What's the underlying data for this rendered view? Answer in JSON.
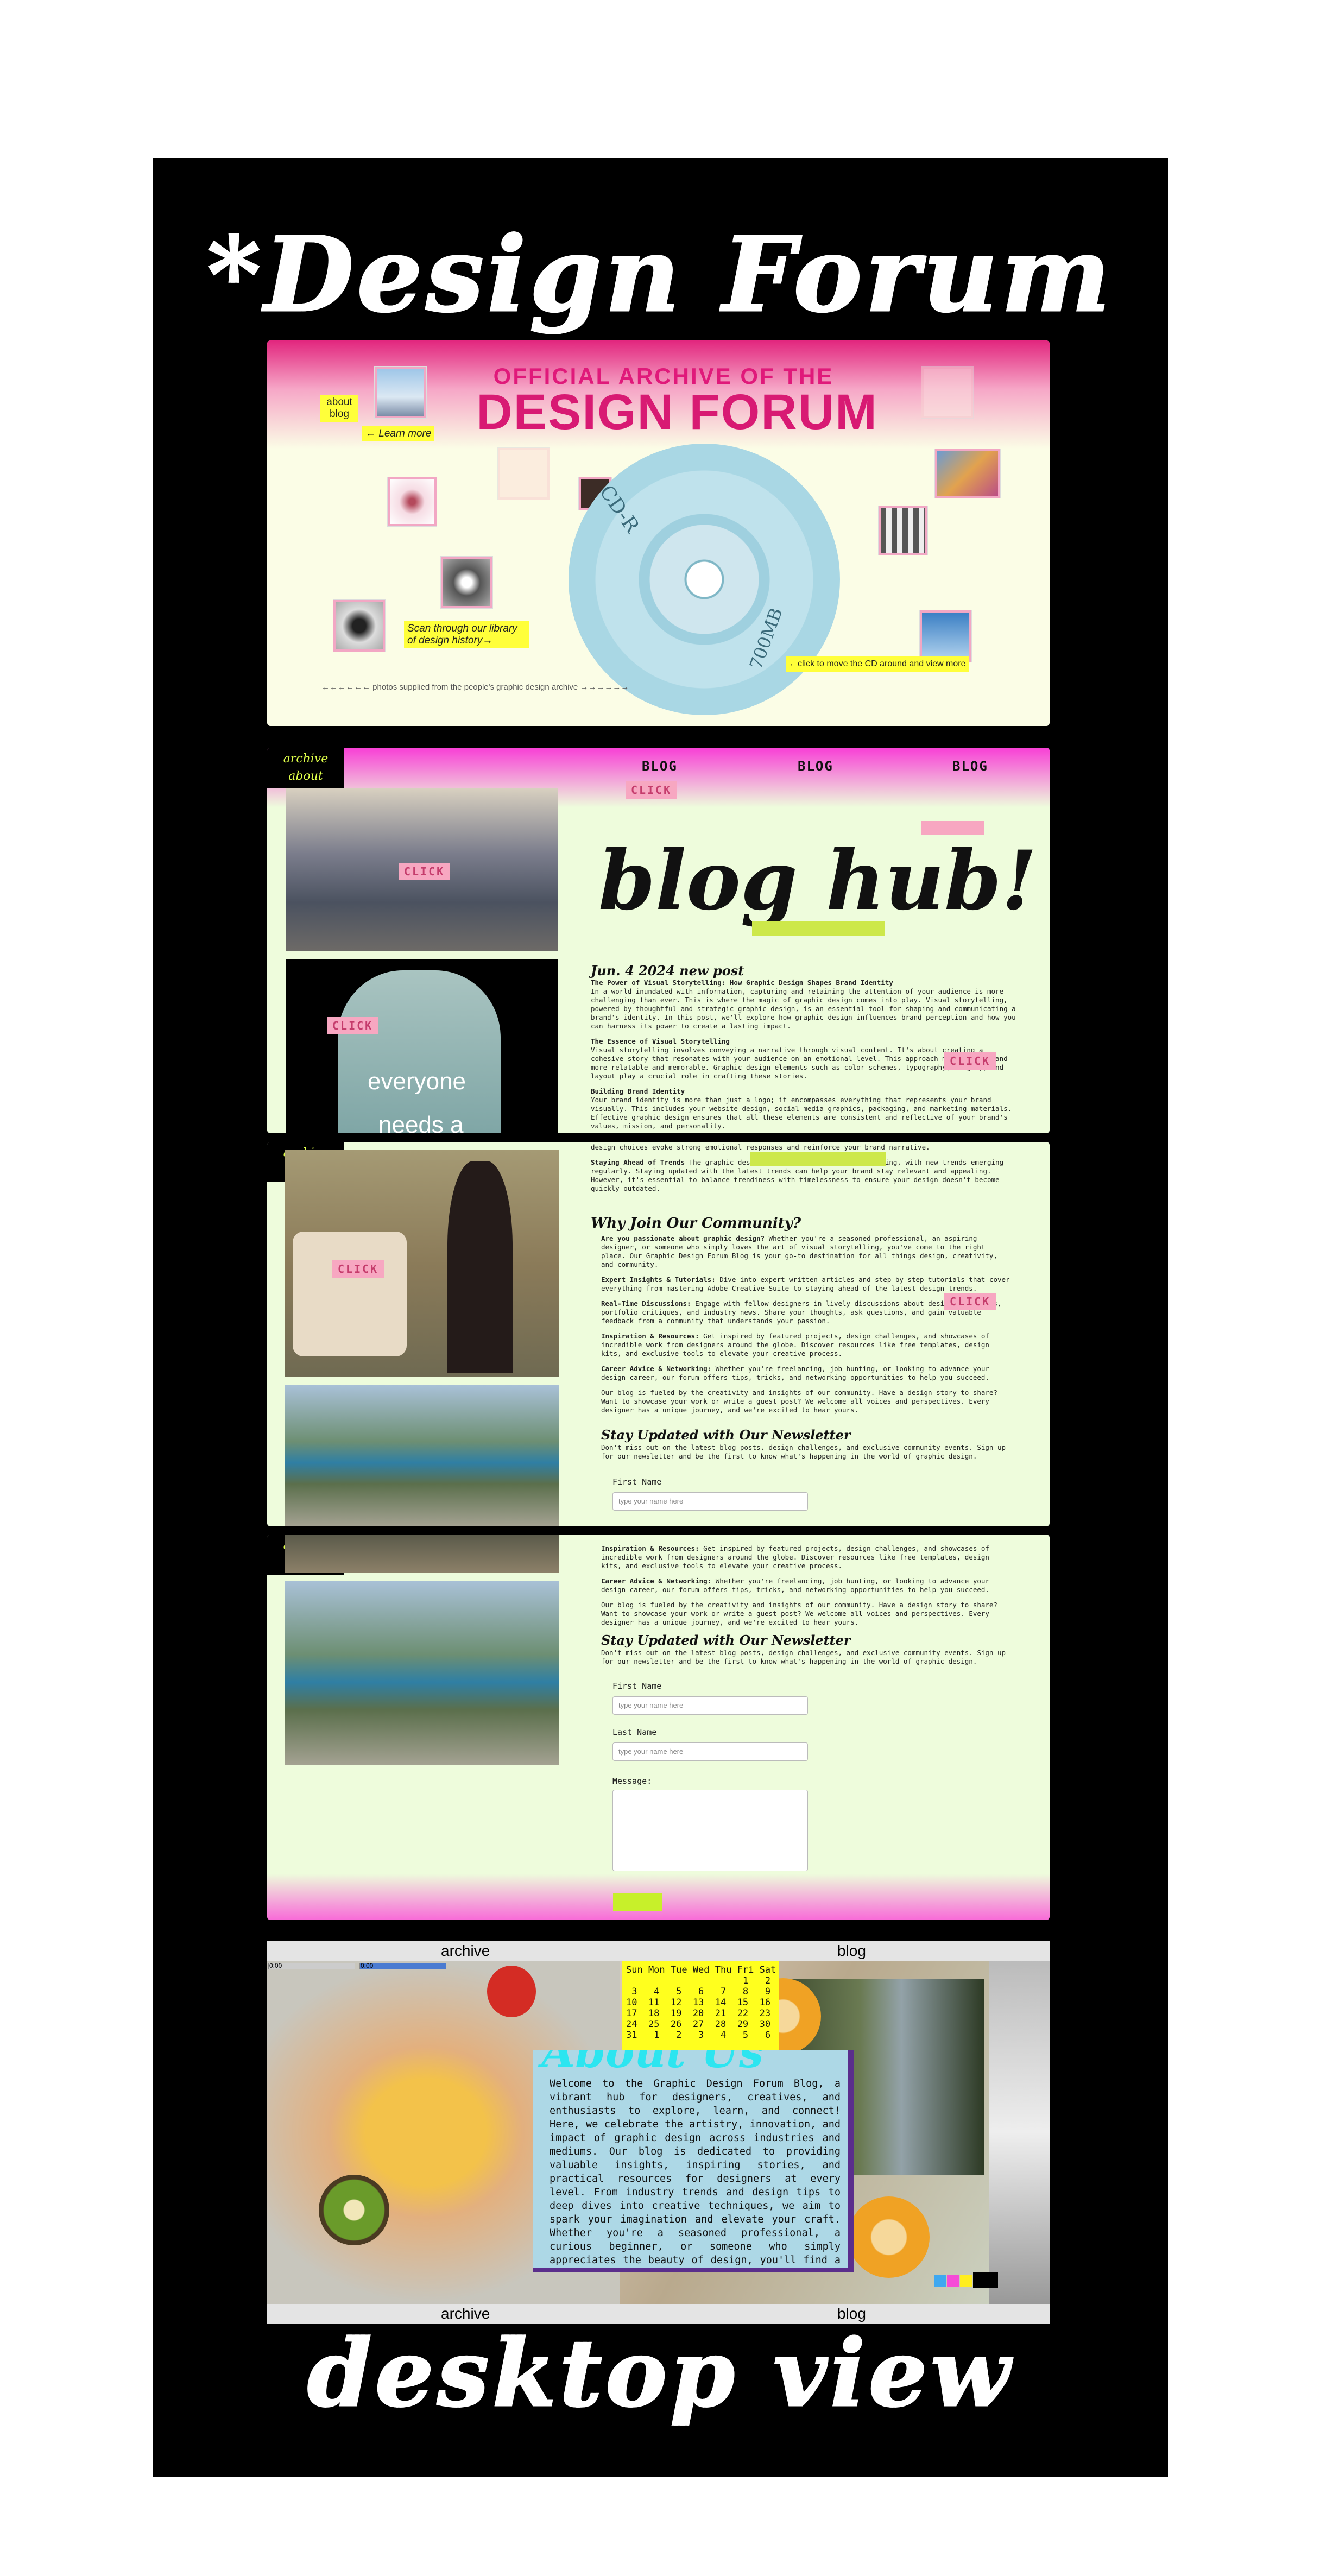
{
  "page": {
    "title_top": "*Design Forum",
    "title_bottom": "desktop view"
  },
  "hero": {
    "kicker": "OFFICIAL ARCHIVE OF THE",
    "title": "DESIGN FORUM",
    "about_blog": "about\nblog",
    "learn_more": "← Learn more",
    "scroll_library": "Scan through our library of design history→",
    "cd_hint": "←click to move the CD around and view more",
    "credit": "←←←←←← photos supplied from the people's graphic design archive →→→→→→",
    "cd_text": "CD-R",
    "cd_capacity": "700MB"
  },
  "tags": {
    "archive": "archive",
    "about": "about"
  },
  "blog": {
    "nav": [
      "BLOG",
      "BLOG",
      "BLOG"
    ],
    "click": "CLICK",
    "title": "blog hub!",
    "shirt_text_1": "everyone",
    "shirt_text_2": "needs a",
    "post_date": "Jun. 4 2024 new post",
    "post_heading": "The Power of Visual Storytelling: How Graphic Design Shapes Brand Identity",
    "post_intro": "In a world inundated with information, capturing and retaining the attention of your audience is more challenging than ever. This is where the magic of graphic design comes into play. Visual storytelling, powered by thoughtful and strategic graphic design, is an essential tool for shaping and communicating a brand's identity. In this post, we'll explore how graphic design influences brand perception and how you can harness its power to create a lasting impact.",
    "essence_heading": "The Essence of Visual Storytelling",
    "essence_text": "Visual storytelling involves conveying a narrative through visual content. It's about creating a cohesive story that resonates with your audience on an emotional level. This approach makes your brand more relatable and memorable. Graphic design elements such as color schemes, typography, imagery, and layout play a crucial role in crafting these stories.",
    "identity_heading": "Building Brand Identity",
    "identity_text": "Your brand identity is more than just a logo; it encompasses everything that represents your brand visually. This includes your website design, social media graphics, packaging, and marketing materials. Effective graphic design ensures that all these elements are consistent and reflective of your brand's values, mission, and personality.",
    "trends_heading": "Staying Ahead of Trends",
    "trends_text": "The graphic design landscape is constantly evolving, with new trends emerging regularly. Staying updated with the latest trends can help your brand stay relevant and appealing. However, it's essential to balance trendiness with timelessness to ensure your design doesn't become quickly outdated.",
    "design_choices": "design choices evoke strong emotional responses and reinforce your brand narrative."
  },
  "community": {
    "heading": "Why Join Our Community?",
    "items": [
      {
        "title": "Are you passionate about graphic design?",
        "text": "Whether you're a seasoned professional, an aspiring designer, or someone who simply loves the art of visual storytelling, you've come to the right place. Our Graphic Design Forum Blog is your go-to destination for all things design, creativity, and community."
      },
      {
        "title": "Expert Insights & Tutorials:",
        "text": "Dive into expert-written articles and step-by-step tutorials that cover everything from mastering Adobe Creative Suite to staying ahead of the latest design trends."
      },
      {
        "title": "Real-Time Discussions:",
        "text": "Engage with fellow designers in lively discussions about design challenges, portfolio critiques, and industry news. Share your thoughts, ask questions, and gain valuable feedback from a community that understands your passion."
      },
      {
        "title": "Inspiration & Resources:",
        "text": "Get inspired by featured projects, design challenges, and showcases of incredible work from designers around the globe. Discover resources like free templates, design kits, and exclusive tools to elevate your creative process."
      },
      {
        "title": "Career Advice & Networking:",
        "text": "Whether you're freelancing, job hunting, or looking to advance your design career, our forum offers tips, tricks, and networking opportunities to help you succeed."
      }
    ],
    "fuel": "Our blog is fueled by the creativity and insights of our community. Have a design story to share? Want to showcase your work or write a guest post? We welcome all voices and perspectives. Every designer has a unique journey, and we're excited to hear yours."
  },
  "newsletter": {
    "heading": "Stay Updated with Our Newsletter",
    "text": "Don't miss out on the latest blog posts, design challenges, and exclusive community events. Sign up for our newsletter and be the first to know what's happening in the world of graphic design.",
    "first_name": "First Name",
    "last_name": "Last Name",
    "message": "Message:",
    "placeholder": "type your name here"
  },
  "desktop": {
    "archive": "archive",
    "blog": "blog",
    "calendar": "Sun Mon Tue Wed Thu Fri Sat\n                     1   2\n 3   4   5   6   7   8   9\n10  11  12  13  14  15  16\n17  18  19  20  21  22  23\n24  25  26  27  28  29  30\n31   1   2   3   4   5   6",
    "about_us": "About Us",
    "welcome": "Welcome to the Graphic Design Forum Blog, a vibrant hub for designers, creatives, and enthusiasts to explore, learn, and connect! Here, we celebrate the artistry, innovation, and impact of graphic design across industries and mediums. Our blog is dedicated to providing valuable insights, inspiring stories, and practical resources for designers at every level. From industry trends and design tips to deep dives into creative techniques, we aim to spark your imagination and elevate your craft. Whether you're a seasoned professional, a curious beginner, or someone who simply appreciates the beauty of design, you'll find a community here that shares your passion. Join us",
    "time_left": "0:00",
    "time_right": "0:00"
  }
}
